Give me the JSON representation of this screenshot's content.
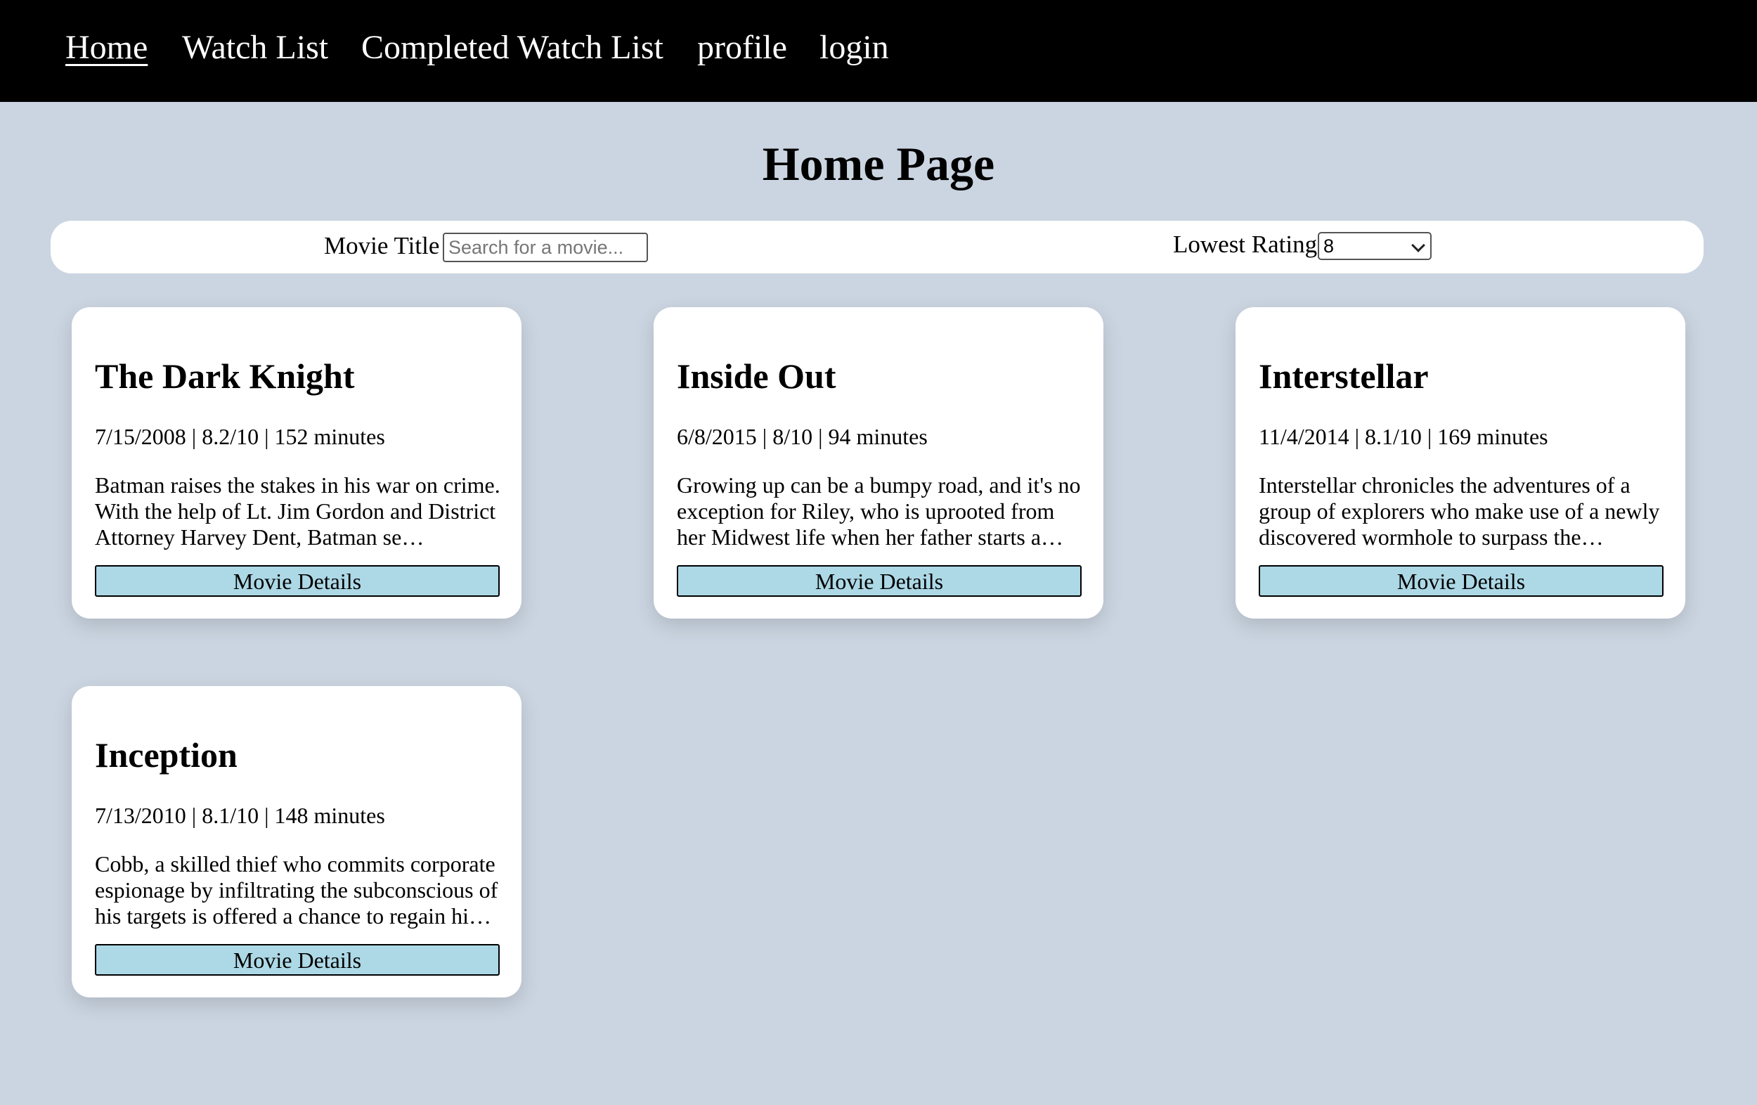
{
  "nav": {
    "items": [
      {
        "label": "Home",
        "active": true
      },
      {
        "label": "Watch List",
        "active": false
      },
      {
        "label": "Completed Watch List",
        "active": false
      },
      {
        "label": "profile",
        "active": false
      },
      {
        "label": "login",
        "active": false
      }
    ]
  },
  "page": {
    "title": "Home Page"
  },
  "filters": {
    "title_label": "Movie Title :",
    "title_placeholder": "Search for a movie...",
    "title_value": "",
    "rating_label": "Lowest Rating :",
    "rating_value": "8"
  },
  "movies": [
    {
      "title": "The Dark Knight",
      "meta": "7/15/2008 | 8.2/10 | 152 minutes",
      "description": "Batman raises the stakes in his war on crime. With the help of Lt. Jim Gordon and District Attorney Harvey Dent, Batman se…",
      "button_label": "Movie Details"
    },
    {
      "title": "Inside Out",
      "meta": "6/8/2015 | 8/10 | 94 minutes",
      "description": "Growing up can be a bumpy road, and it's no exception for Riley, who is uprooted from her Midwest life when her father starts a…",
      "button_label": "Movie Details"
    },
    {
      "title": "Interstellar",
      "meta": "11/4/2014 | 8.1/10 | 169 minutes",
      "description": "Interstellar chronicles the adventures of a group of explorers who make use of a newly discovered wormhole to surpass the…",
      "button_label": "Movie Details"
    },
    {
      "title": "Inception",
      "meta": "7/13/2010 | 8.1/10 | 148 minutes",
      "description": "Cobb, a skilled thief who commits corporate espionage by infiltrating the subconscious of his targets is offered a chance to regain hi…",
      "button_label": "Movie Details"
    }
  ],
  "colors": {
    "navbar_bg": "#000000",
    "page_bg": "#cbd5e1",
    "button_bg": "#add8e6"
  }
}
